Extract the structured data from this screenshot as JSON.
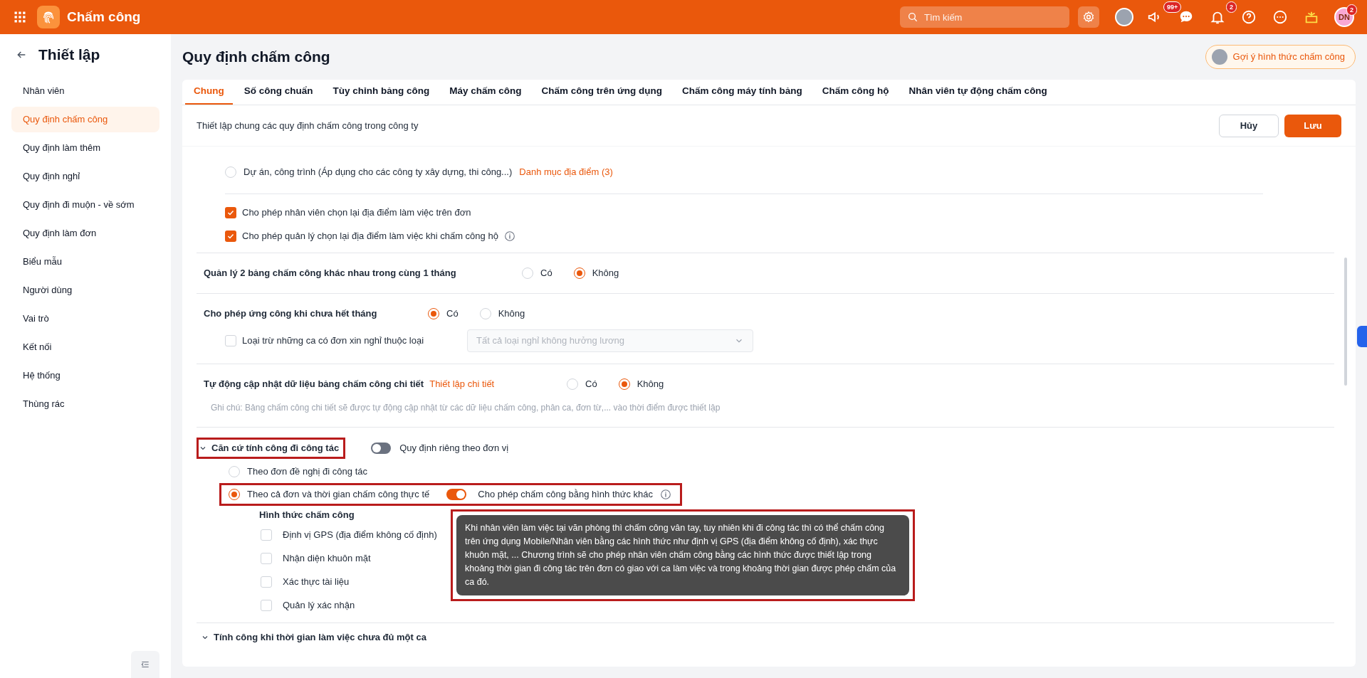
{
  "app": {
    "title": "Chấm công",
    "search": {
      "placeholder": "Tìm kiếm"
    },
    "badges": [
      "99+",
      "2"
    ],
    "user": {
      "initials": "DN",
      "badge": "2"
    }
  },
  "sidebar": {
    "title": "Thiết lập",
    "items": [
      {
        "label": "Nhân viên",
        "selected": false
      },
      {
        "label": "Quy định chấm công",
        "selected": true
      },
      {
        "label": "Quy định làm thêm",
        "selected": false
      },
      {
        "label": "Quy định nghỉ",
        "selected": false
      },
      {
        "label": "Quy định đi muộn - về sớm",
        "selected": false
      },
      {
        "label": "Quy định làm đơn",
        "selected": false
      },
      {
        "label": "Biểu mẫu",
        "selected": false
      },
      {
        "label": "Người dùng",
        "selected": false
      },
      {
        "label": "Vai trò",
        "selected": false
      },
      {
        "label": "Kết nối",
        "selected": false
      },
      {
        "label": "Hệ thống",
        "selected": false
      },
      {
        "label": "Thùng rác",
        "selected": false
      }
    ]
  },
  "page": {
    "title": "Quy định chấm công",
    "suggest_button": "Gợi ý hình thức chấm công"
  },
  "tabs": [
    {
      "label": "Chung",
      "selected": true
    },
    {
      "label": "Số công chuẩn",
      "selected": false
    },
    {
      "label": "Tùy chỉnh bảng công",
      "selected": false
    },
    {
      "label": "Máy chấm công",
      "selected": false
    },
    {
      "label": "Chấm công trên ứng dụng",
      "selected": false
    },
    {
      "label": "Chấm công máy tính bảng",
      "selected": false
    },
    {
      "label": "Chấm công hộ",
      "selected": false
    },
    {
      "label": "Nhân viên tự động chấm công",
      "selected": false
    }
  ],
  "subheader": {
    "text": "Thiết lập chung các quy định chấm công trong công ty",
    "buttons": [
      "Hủy",
      "Lưu"
    ]
  },
  "location": {
    "option": {
      "label": "Dự án, công trình (Áp dụng cho các công ty xây dựng, thi công...)",
      "selected": false,
      "link": "Danh mục địa điểm (3)"
    },
    "checkboxes": [
      {
        "label": "Cho phép nhân viên chọn lại địa điểm làm việc trên đơn",
        "checked": true,
        "info": false
      },
      {
        "label": "Cho phép quản lý chọn lại địa điểm làm việc khi chấm công hộ",
        "checked": true,
        "info": true
      }
    ]
  },
  "two_timesheets": {
    "label": "Quản lý 2 bảng chấm công khác nhau trong cùng 1 tháng",
    "options": [
      {
        "label": "Có",
        "selected": false
      },
      {
        "label": "Không",
        "selected": true
      }
    ]
  },
  "advance": {
    "label": "Cho phép ứng công khi chưa hết tháng",
    "options": [
      {
        "label": "Có",
        "selected": true
      },
      {
        "label": "Không",
        "selected": false
      }
    ],
    "exclude": {
      "label": "Loại trừ những ca có đơn xin nghỉ thuộc loại",
      "checked": false,
      "select": {
        "value": "Tất cả loại nghỉ không hưởng lương",
        "disabled": true
      }
    }
  },
  "auto_update": {
    "label": "Tự động cập nhật dữ liệu bảng chấm công chi tiết",
    "link": "Thiết lập chi tiết",
    "options": [
      {
        "label": "Có",
        "selected": false
      },
      {
        "label": "Không",
        "selected": true
      }
    ],
    "note": "Ghi chú: Bảng chấm công chi tiết sẽ được tự động cập nhật từ các dữ liệu chấm công, phân ca, đơn từ,... vào thời điểm được thiết lập"
  },
  "business_trip": {
    "title": "Căn cứ tính công đi công tác",
    "highlighted": true,
    "toggle": {
      "label": "Quy định riêng theo đơn vị",
      "on": false
    },
    "options": [
      {
        "label": "Theo đơn đề nghị đi công tác",
        "selected": false,
        "highlighted": false
      },
      {
        "label": "Theo cả đơn và thời gian chấm công thực tế",
        "selected": true,
        "highlighted": true,
        "toggle": {
          "label": "Cho phép chấm công bằng hình thức khác",
          "on": true
        }
      }
    ],
    "methods": {
      "title": "Hình thức chấm công",
      "items": [
        {
          "label": "Định vị GPS (địa điểm không cố định)",
          "checked": false
        },
        {
          "label": "Nhận diện khuôn mặt",
          "checked": false
        },
        {
          "label": "Xác thực tài liệu",
          "checked": false
        },
        {
          "label": "Quản lý xác nhận",
          "checked": false
        }
      ]
    },
    "tooltip": {
      "text": "Khi nhân viên làm việc tại văn phòng thì chấm công vân tay, tuy nhiên khi đi công tác thì có thể chấm công trên ứng dụng Mobile/Nhân viên bằng các hình thức như định vị GPS (địa điểm không cố định), xác thực khuôn mặt, ... Chương trình sẽ cho phép nhân viên chấm công bằng các hình thức được thiết lập trong khoảng thời gian đi công tác trên đơn có giao với ca làm việc và trong khoảng thời gian được phép chấm của ca đó.",
      "highlighted": true
    }
  },
  "next_section": {
    "title": "Tính công khi thời gian làm việc chưa đủ một ca"
  }
}
